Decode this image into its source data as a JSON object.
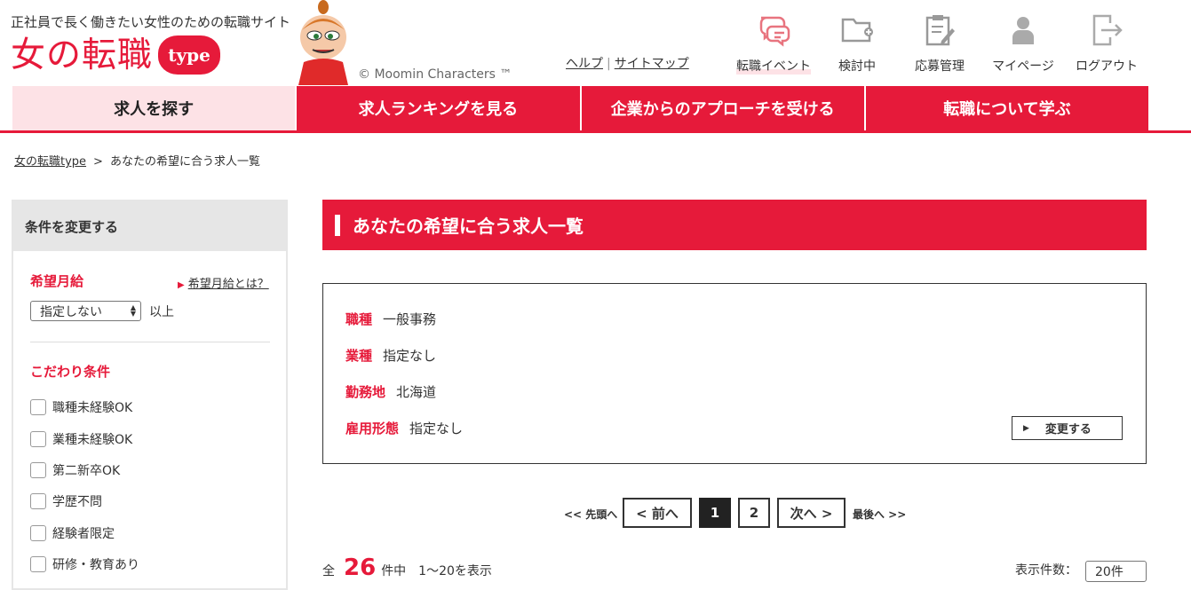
{
  "header": {
    "tagline": "正社員で長く働きたい女性のための転職サイト",
    "logo_text": "女の転職",
    "logo_badge": "type",
    "copyright": "© Moomin Characters ™",
    "help_link": "ヘルプ",
    "sitemap_link": "サイトマップ",
    "icons": [
      {
        "label": "転職イベント",
        "icon": "event-chat-icon"
      },
      {
        "label": "検討中",
        "icon": "folder-add-icon"
      },
      {
        "label": "応募管理",
        "icon": "clipboard-edit-icon"
      },
      {
        "label": "マイページ",
        "icon": "user-icon"
      },
      {
        "label": "ログアウト",
        "icon": "logout-icon"
      }
    ]
  },
  "nav": [
    {
      "label": "求人を探す"
    },
    {
      "label": "求人ランキングを見る"
    },
    {
      "label": "企業からのアプローチを受ける"
    },
    {
      "label": "転職について学ぶ"
    }
  ],
  "breadcrumb": {
    "home": "女の転職type",
    "separator": ">",
    "current": "あなたの希望に合う求人一覧"
  },
  "sidebar": {
    "heading": "条件を変更する",
    "salary_title": "希望月給",
    "salary_help": "希望月給とは？",
    "salary_select": "指定しない",
    "salary_suffix": "以上",
    "kodawari_title": "こだわり条件",
    "checkboxes": [
      {
        "label": "職種未経験OK"
      },
      {
        "label": "業種未経験OK"
      },
      {
        "label": "第二新卒OK"
      },
      {
        "label": "学歴不問"
      },
      {
        "label": "経験者限定"
      },
      {
        "label": "研修・教育あり"
      }
    ]
  },
  "main": {
    "title": "あなたの希望に合う求人一覧",
    "conditions": [
      {
        "key": "職種",
        "value": "一般事務"
      },
      {
        "key": "業種",
        "value": "指定なし"
      },
      {
        "key": "勤務地",
        "value": "北海道"
      },
      {
        "key": "雇用形態",
        "value": "指定なし"
      }
    ],
    "change_button": "変更する"
  },
  "pagination": {
    "first": "<<  先頭へ",
    "prev": "< 前へ",
    "pages": [
      "1",
      "2"
    ],
    "next": "次へ >",
    "last": "最後へ  >>"
  },
  "results": {
    "prefix": "全",
    "count": "26",
    "suffix": "件中　1～20を表示",
    "per_page_label": "表示件数：",
    "per_page_value": "20件"
  },
  "colors": {
    "accent": "#e61a3a",
    "accent_light": "#fde2e6"
  }
}
